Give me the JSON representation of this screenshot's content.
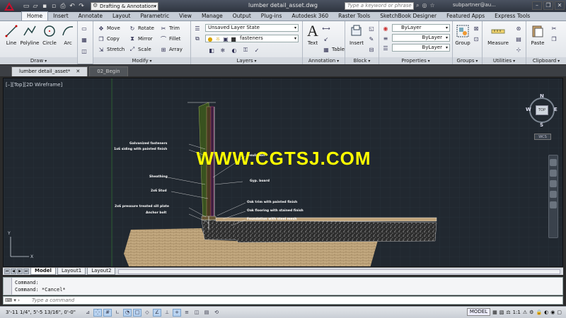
{
  "window": {
    "title": "lumber detail_asset.dwg",
    "workspace": "Drafting & Annotation",
    "search_placeholder": "Type a keyword or phrase",
    "user": "subpartner@au..."
  },
  "ribbon_tabs": [
    "Home",
    "Insert",
    "Annotate",
    "Layout",
    "Parametric",
    "View",
    "Manage",
    "Output",
    "Plug-ins",
    "Autodesk 360",
    "Raster Tools",
    "SketchBook Designer",
    "Featured Apps",
    "Express Tools"
  ],
  "active_ribbon_tab": "Home",
  "panels": {
    "draw": {
      "label": "Draw",
      "tools": [
        "Line",
        "Polyline",
        "Circle",
        "Arc"
      ]
    },
    "modify": {
      "label": "Modify",
      "tools": [
        "Move",
        "Rotate",
        "Trim",
        "Copy",
        "Mirror",
        "Fillet",
        "Stretch",
        "Scale",
        "Array"
      ]
    },
    "layers": {
      "label": "Layers",
      "layer_state": "Unsaved Layer State",
      "current_layer": "fasteners"
    },
    "annotation": {
      "label": "Annotation",
      "tools": [
        "Text",
        "Table"
      ]
    },
    "block": {
      "label": "Block",
      "tools": [
        "Insert"
      ]
    },
    "properties": {
      "label": "Properties",
      "color": "ByLayer",
      "linetype": "ByLayer",
      "lineweight": "ByLayer"
    },
    "groups": {
      "label": "Groups",
      "tools": [
        "Group"
      ]
    },
    "utilities": {
      "label": "Utilities",
      "tools": [
        "Measure"
      ]
    },
    "clipboard": {
      "label": "Clipboard",
      "tools": [
        "Paste"
      ]
    }
  },
  "file_tabs": [
    {
      "label": "lumber detail_asset*",
      "active": true
    },
    {
      "label": "02_Begin",
      "active": false
    }
  ],
  "viewport": {
    "label": "[–][Top][2D Wireframe]",
    "watermark": "WWW.CGTSJ.COM",
    "annotations_left": [
      "Galvanized fasteners",
      "1x6 siding with painted finish",
      "Sheathing",
      "2x6 Stud",
      "2x6 pressure treated sill plate",
      "Anchor bolt"
    ],
    "annotations_right": [
      "Insulation",
      "Gyp. board",
      "Oak trim with painted finish",
      "Oak flooring with stained finish",
      "Foundation with steel mesh"
    ],
    "viewcube": {
      "n": "N",
      "s": "S",
      "e": "E",
      "w": "W",
      "top": "TOP",
      "wcs": "WCS"
    }
  },
  "layout_tabs": [
    {
      "label": "Model",
      "active": true
    },
    {
      "label": "Layout1",
      "active": false
    },
    {
      "label": "Layout2",
      "active": false
    }
  ],
  "command": {
    "history": [
      "Command:",
      "Command: *Cancel*"
    ],
    "placeholder": "Type a command"
  },
  "status": {
    "coords": "3'-11 1/4\",  5'-5 13/16\", 0'-0\"",
    "model": "MODEL",
    "scale": "1:1"
  }
}
